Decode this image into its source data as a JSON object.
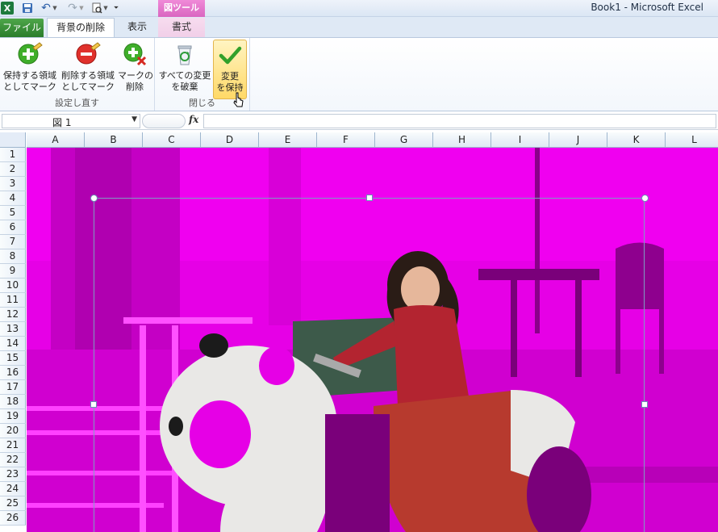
{
  "titlebar": {
    "context_group": "図ツール",
    "window_title": "Book1 - Microsoft Excel",
    "qat": [
      "excel-logo",
      "save-icon",
      "undo-icon",
      "redo-icon",
      "print-preview-icon",
      "customize-icon"
    ]
  },
  "tabs": {
    "file": "ファイル",
    "background_removal": "背景の削除",
    "view": "表示",
    "format": "書式"
  },
  "ribbon": {
    "refine_group": {
      "label": "設定し直す",
      "mark_keep": {
        "line1": "保持する領域",
        "line2": "としてマーク"
      },
      "mark_remove": {
        "line1": "削除する領域",
        "line2": "としてマーク"
      },
      "delete_mark": {
        "line1": "マークの",
        "line2": "削除"
      }
    },
    "close_group": {
      "label": "閉じる",
      "discard_all": {
        "line1": "すべての変更",
        "line2": "を破棄"
      },
      "keep_changes": {
        "line1": "変更",
        "line2": "を保持"
      }
    }
  },
  "formula_bar": {
    "name_box": "図 1",
    "fx_label": "fx",
    "formula": ""
  },
  "grid": {
    "columns": [
      "A",
      "B",
      "C",
      "D",
      "E",
      "F",
      "G",
      "H",
      "I",
      "J",
      "K",
      "L"
    ],
    "rows": [
      "1",
      "2",
      "3",
      "4",
      "5",
      "6",
      "7",
      "8",
      "9",
      "10",
      "11",
      "12",
      "13",
      "14",
      "15",
      "16",
      "17",
      "18",
      "19",
      "20",
      "21",
      "22",
      "23",
      "24",
      "25",
      "26"
    ]
  },
  "picture": {
    "removal_overlay_color": "#e600e6",
    "description_colors": {
      "shirt": "#b32430",
      "jeans": "#3b4a6e",
      "panda_white": "#e9e8e6",
      "panda_black": "#1b1b1b",
      "saddle": "#b73a2e"
    }
  }
}
